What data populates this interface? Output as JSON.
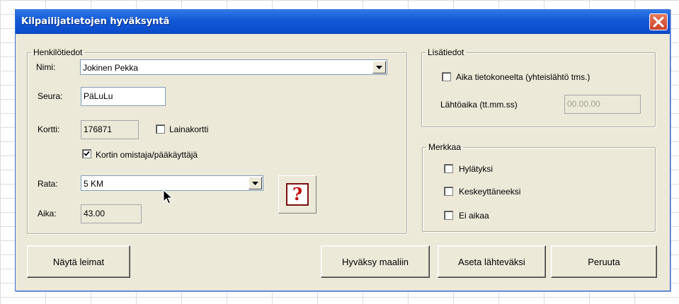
{
  "window": {
    "title": "Kilpailijatietojen hyväksyntä"
  },
  "henkilotiedot": {
    "legend": "Henkilötiedot",
    "nimi_label": "Nimi:",
    "nimi_value": "Jokinen Pekka",
    "seura_label": "Seura:",
    "seura_value": "PäLuLu",
    "kortti_label": "Kortti:",
    "kortti_value": "176871",
    "lainakortti_label": "Lainakortti",
    "lainakortti_checked": false,
    "omistaja_label": "Kortin omistaja/pääkäyttäjä",
    "omistaja_checked": true,
    "rata_label": "Rata:",
    "rata_value": "5 KM",
    "aika_label": "Aika:",
    "aika_value": "43.00",
    "help_symbol": "?"
  },
  "lisatiedot": {
    "legend": "Lisätiedot",
    "aika_tietokoneelta_label": "Aika tietokoneelta (yhteislähtö tms.)",
    "aika_tietokoneelta_checked": false,
    "lahtoaika_label": "Lähtöaika (tt.mm.ss)",
    "lahtoaika_value": "00.00.00"
  },
  "merkkaa": {
    "legend": "Merkkaa",
    "hylatyksi_label": "Hylätyksi",
    "keskeyttaneeksi_label": "Keskeyttäneeksi",
    "ei_aikaa_label": "Ei aikaa"
  },
  "buttons": {
    "nayta_leimat": "Näytä leimat",
    "hyvaksy_maaliin": "Hyväksy maaliin",
    "aseta_lahtevaksi": "Aseta lähteväksi",
    "peruuta": "Peruuta"
  },
  "colors": {
    "titlebar": "#0a4bcd",
    "dialog_bg": "#ece9d8",
    "close_button": "#c9422a"
  }
}
